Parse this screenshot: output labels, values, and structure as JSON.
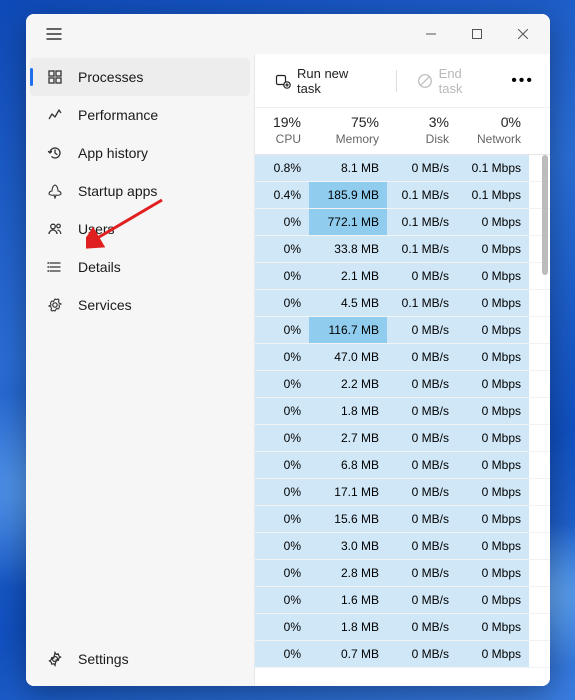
{
  "sidebar": {
    "items": [
      {
        "label": "Processes",
        "icon": "processes-icon",
        "active": true
      },
      {
        "label": "Performance",
        "icon": "performance-icon",
        "active": false
      },
      {
        "label": "App history",
        "icon": "history-icon",
        "active": false
      },
      {
        "label": "Startup apps",
        "icon": "startup-icon",
        "active": false
      },
      {
        "label": "Users",
        "icon": "users-icon",
        "active": false
      },
      {
        "label": "Details",
        "icon": "details-icon",
        "active": false
      },
      {
        "label": "Services",
        "icon": "services-icon",
        "active": false
      }
    ],
    "settings_label": "Settings"
  },
  "toolbar": {
    "run_label": "Run new task",
    "end_label": "End task"
  },
  "columns": {
    "cpu": {
      "pct": "19%",
      "label": "CPU"
    },
    "memory": {
      "pct": "75%",
      "label": "Memory"
    },
    "disk": {
      "pct": "3%",
      "label": "Disk"
    },
    "network": {
      "pct": "0%",
      "label": "Network"
    }
  },
  "rows": [
    {
      "cpu": "0.8%",
      "mem": "8.1 MB",
      "mem_hi": false,
      "disk": "0 MB/s",
      "net": "0.1 Mbps"
    },
    {
      "cpu": "0.4%",
      "mem": "185.9 MB",
      "mem_hi": true,
      "disk": "0.1 MB/s",
      "net": "0.1 Mbps"
    },
    {
      "cpu": "0%",
      "mem": "772.1 MB",
      "mem_hi": true,
      "disk": "0.1 MB/s",
      "net": "0 Mbps"
    },
    {
      "cpu": "0%",
      "mem": "33.8 MB",
      "mem_hi": false,
      "disk": "0.1 MB/s",
      "net": "0 Mbps"
    },
    {
      "cpu": "0%",
      "mem": "2.1 MB",
      "mem_hi": false,
      "disk": "0 MB/s",
      "net": "0 Mbps"
    },
    {
      "cpu": "0%",
      "mem": "4.5 MB",
      "mem_hi": false,
      "disk": "0.1 MB/s",
      "net": "0 Mbps"
    },
    {
      "cpu": "0%",
      "mem": "116.7 MB",
      "mem_hi": true,
      "disk": "0 MB/s",
      "net": "0 Mbps"
    },
    {
      "cpu": "0%",
      "mem": "47.0 MB",
      "mem_hi": false,
      "disk": "0 MB/s",
      "net": "0 Mbps"
    },
    {
      "cpu": "0%",
      "mem": "2.2 MB",
      "mem_hi": false,
      "disk": "0 MB/s",
      "net": "0 Mbps"
    },
    {
      "cpu": "0%",
      "mem": "1.8 MB",
      "mem_hi": false,
      "disk": "0 MB/s",
      "net": "0 Mbps"
    },
    {
      "cpu": "0%",
      "mem": "2.7 MB",
      "mem_hi": false,
      "disk": "0 MB/s",
      "net": "0 Mbps"
    },
    {
      "cpu": "0%",
      "mem": "6.8 MB",
      "mem_hi": false,
      "disk": "0 MB/s",
      "net": "0 Mbps"
    },
    {
      "cpu": "0%",
      "mem": "17.1 MB",
      "mem_hi": false,
      "disk": "0 MB/s",
      "net": "0 Mbps"
    },
    {
      "cpu": "0%",
      "mem": "15.6 MB",
      "mem_hi": false,
      "disk": "0 MB/s",
      "net": "0 Mbps"
    },
    {
      "cpu": "0%",
      "mem": "3.0 MB",
      "mem_hi": false,
      "disk": "0 MB/s",
      "net": "0 Mbps"
    },
    {
      "cpu": "0%",
      "mem": "2.8 MB",
      "mem_hi": false,
      "disk": "0 MB/s",
      "net": "0 Mbps"
    },
    {
      "cpu": "0%",
      "mem": "1.6 MB",
      "mem_hi": false,
      "disk": "0 MB/s",
      "net": "0 Mbps"
    },
    {
      "cpu": "0%",
      "mem": "1.8 MB",
      "mem_hi": false,
      "disk": "0 MB/s",
      "net": "0 Mbps"
    },
    {
      "cpu": "0%",
      "mem": "0.7 MB",
      "mem_hi": false,
      "disk": "0 MB/s",
      "net": "0 Mbps"
    }
  ]
}
